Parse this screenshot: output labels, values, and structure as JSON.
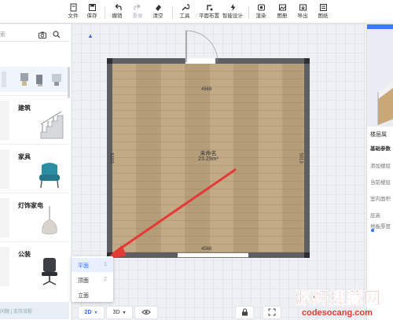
{
  "toolbar": {
    "file": "文件",
    "save": "保存",
    "undo": "撤销",
    "redo": "重做",
    "clear": "清空",
    "tools": "工具",
    "layout": "平面布置",
    "smart_design": "智能设计",
    "render": "渲染",
    "gallery": "图册",
    "export": "导出",
    "drawing": "图纸"
  },
  "left_panel": {
    "search_placeholder": "索",
    "categories": [
      {
        "label": "建筑",
        "icon": "staircase-icon"
      },
      {
        "label": "家具",
        "icon": "armchair-icon"
      },
      {
        "label": "灯饰家电",
        "icon": "pendant-lamp-icon"
      },
      {
        "label": "公装",
        "icon": "office-chair-icon"
      }
    ],
    "bottom_links": "问题 | 支持流程"
  },
  "canvas": {
    "room_name": "未命名",
    "room_area": "23.29m²",
    "dim_top": "4568",
    "dim_bottom": "4568",
    "dim_left": "5103",
    "dim_right": "5013"
  },
  "view_menu": {
    "options": [
      {
        "label": "平面",
        "key": "1",
        "selected": true
      },
      {
        "label": "顶面",
        "key": "2",
        "selected": false
      },
      {
        "label": "立面",
        "key": "",
        "selected": false
      }
    ]
  },
  "bottom_bar": {
    "mode_2d": "2D",
    "mode_3d": "3D"
  },
  "right_panel": {
    "title": "楼层属",
    "section": "基础参数",
    "rows": [
      "添加楼层",
      "当前楼层",
      "室内面积",
      "层高",
      "地板厚度"
    ]
  },
  "watermark": {
    "title": "源码搜藏网",
    "url": "codesocang.com"
  },
  "colors": {
    "accent": "#3370ff",
    "arrow": "#e53935",
    "wall": "#5d5f63",
    "watermark": "#e63b2e"
  }
}
